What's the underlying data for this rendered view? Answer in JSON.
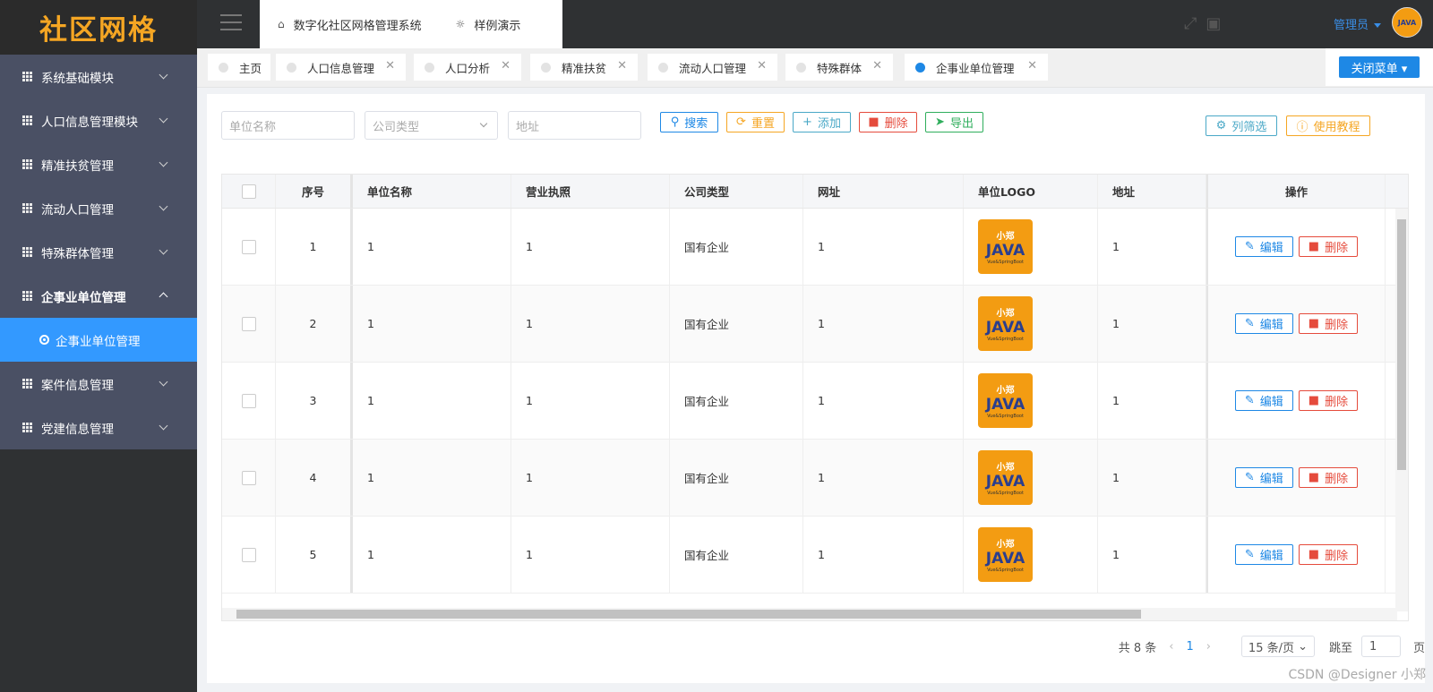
{
  "app": {
    "logo": "社区网格"
  },
  "sidebar": {
    "items": [
      {
        "label": "系统基础模块"
      },
      {
        "label": "人口信息管理模块"
      },
      {
        "label": "精准扶贫管理"
      },
      {
        "label": "流动人口管理"
      },
      {
        "label": "特殊群体管理"
      },
      {
        "label": "企事业单位管理"
      },
      {
        "label": "案件信息管理"
      },
      {
        "label": "党建信息管理"
      }
    ],
    "sub_active": "企事业单位管理"
  },
  "topbar": {
    "tab1": "数字化社区网格管理系统",
    "tab2": "样例演示",
    "user": "管理员",
    "avatar_text": "JAVA"
  },
  "page_tabs": [
    {
      "label": "主页"
    },
    {
      "label": "人口信息管理"
    },
    {
      "label": "人口分析"
    },
    {
      "label": "精准扶贫"
    },
    {
      "label": "流动人口管理"
    },
    {
      "label": "特殊群体"
    },
    {
      "label": "企事业单位管理"
    }
  ],
  "close_menu": "关闭菜单",
  "filters": {
    "name_placeholder": "单位名称",
    "type_placeholder": "公司类型",
    "addr_placeholder": "地址"
  },
  "toolbar": {
    "search": "搜索",
    "reset": "重置",
    "add": "添加",
    "delete": "删除",
    "export": "导出",
    "columns": "列筛选",
    "tutorial": "使用教程"
  },
  "table": {
    "headers": [
      "序号",
      "单位名称",
      "营业执照",
      "公司类型",
      "网址",
      "单位LOGO",
      "地址",
      "操作"
    ],
    "rows": [
      {
        "no": "1",
        "name": "1",
        "license": "1",
        "type": "国有企业",
        "url": "1",
        "addr": "1"
      },
      {
        "no": "2",
        "name": "1",
        "license": "1",
        "type": "国有企业",
        "url": "1",
        "addr": "1"
      },
      {
        "no": "3",
        "name": "1",
        "license": "1",
        "type": "国有企业",
        "url": "1",
        "addr": "1"
      },
      {
        "no": "4",
        "name": "1",
        "license": "1",
        "type": "国有企业",
        "url": "1",
        "addr": "1"
      },
      {
        "no": "5",
        "name": "1",
        "license": "1",
        "type": "国有企业",
        "url": "1",
        "addr": "1"
      }
    ],
    "edit": "编辑",
    "remove": "删除",
    "logo_text": {
      "top": "小郑",
      "mid": "JAVA",
      "bottom": "Vue&SpringBoot"
    }
  },
  "pager": {
    "total": "共 8 条",
    "page": "1",
    "size": "15 条/页",
    "jump_label": "跳至",
    "jump_value": "1",
    "page_suffix": "页"
  },
  "watermark": "CSDN @Designer 小郑"
}
